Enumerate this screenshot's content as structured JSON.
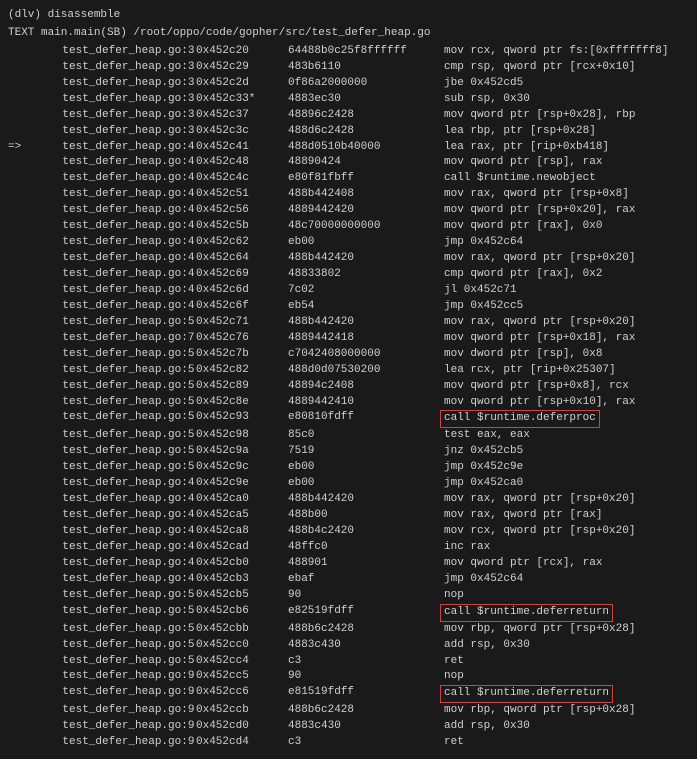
{
  "prompt": "(dlv) disassemble",
  "text_header": "TEXT main.main(SB) /root/oppo/code/gopher/src/test_defer_heap.go",
  "rows": [
    {
      "arrow": "",
      "file": "test_defer_heap.go:3",
      "addr": "0x452c20",
      "bytes": "64488b0c25f8ffffff",
      "instr": "mov rcx, qword ptr fs:[0xfffffff8]",
      "hl": false
    },
    {
      "arrow": "",
      "file": "test_defer_heap.go:3",
      "addr": "0x452c29",
      "bytes": "483b6110",
      "instr": "cmp rsp, qword ptr [rcx+0x10]",
      "hl": false
    },
    {
      "arrow": "",
      "file": "test_defer_heap.go:3",
      "addr": "0x452c2d",
      "bytes": "0f86a2000000",
      "instr": "jbe 0x452cd5",
      "hl": false
    },
    {
      "arrow": "",
      "file": "test_defer_heap.go:3",
      "addr": "0x452c33*",
      "bytes": "4883ec30",
      "instr": "sub rsp, 0x30",
      "hl": false
    },
    {
      "arrow": "",
      "file": "test_defer_heap.go:3",
      "addr": "0x452c37",
      "bytes": "48896c2428",
      "instr": "mov qword ptr [rsp+0x28], rbp",
      "hl": false
    },
    {
      "arrow": "",
      "file": "test_defer_heap.go:3",
      "addr": "0x452c3c",
      "bytes": "488d6c2428",
      "instr": "lea rbp, ptr [rsp+0x28]",
      "hl": false
    },
    {
      "arrow": "=>",
      "file": "test_defer_heap.go:4",
      "addr": "0x452c41",
      "bytes": "488d0510b40000",
      "instr": "lea rax, ptr [rip+0xb418]",
      "hl": false
    },
    {
      "arrow": "",
      "file": "test_defer_heap.go:4",
      "addr": "0x452c48",
      "bytes": "48890424",
      "instr": "mov qword ptr [rsp], rax",
      "hl": false
    },
    {
      "arrow": "",
      "file": "test_defer_heap.go:4",
      "addr": "0x452c4c",
      "bytes": "e80f81fbff",
      "instr": "call $runtime.newobject",
      "hl": false
    },
    {
      "arrow": "",
      "file": "test_defer_heap.go:4",
      "addr": "0x452c51",
      "bytes": "488b442408",
      "instr": "mov rax, qword ptr [rsp+0x8]",
      "hl": false
    },
    {
      "arrow": "",
      "file": "test_defer_heap.go:4",
      "addr": "0x452c56",
      "bytes": "4889442420",
      "instr": "mov qword ptr [rsp+0x20], rax",
      "hl": false
    },
    {
      "arrow": "",
      "file": "test_defer_heap.go:4",
      "addr": "0x452c5b",
      "bytes": "48c70000000000",
      "instr": "mov qword ptr [rax], 0x0",
      "hl": false
    },
    {
      "arrow": "",
      "file": "test_defer_heap.go:4",
      "addr": "0x452c62",
      "bytes": "eb00",
      "instr": "jmp 0x452c64",
      "hl": false
    },
    {
      "arrow": "",
      "file": "test_defer_heap.go:4",
      "addr": "0x452c64",
      "bytes": "488b442420",
      "instr": "mov rax, qword ptr [rsp+0x20]",
      "hl": false
    },
    {
      "arrow": "",
      "file": "test_defer_heap.go:4",
      "addr": "0x452c69",
      "bytes": "48833802",
      "instr": "cmp qword ptr [rax], 0x2",
      "hl": false
    },
    {
      "arrow": "",
      "file": "test_defer_heap.go:4",
      "addr": "0x452c6d",
      "bytes": "7c02",
      "instr": "jl 0x452c71",
      "hl": false
    },
    {
      "arrow": "",
      "file": "test_defer_heap.go:4",
      "addr": "0x452c6f",
      "bytes": "eb54",
      "instr": "jmp 0x452cc5",
      "hl": false
    },
    {
      "arrow": "",
      "file": "test_defer_heap.go:5",
      "addr": "0x452c71",
      "bytes": "488b442420",
      "instr": "mov rax, qword ptr [rsp+0x20]",
      "hl": false
    },
    {
      "arrow": "",
      "file": "test_defer_heap.go:7",
      "addr": "0x452c76",
      "bytes": "4889442418",
      "instr": "mov qword ptr [rsp+0x18], rax",
      "hl": false
    },
    {
      "arrow": "",
      "file": "test_defer_heap.go:5",
      "addr": "0x452c7b",
      "bytes": "c7042408000000",
      "instr": "mov dword ptr [rsp], 0x8",
      "hl": false
    },
    {
      "arrow": "",
      "file": "test_defer_heap.go:5",
      "addr": "0x452c82",
      "bytes": "488d0d07530200",
      "instr": "lea rcx, ptr [rip+0x25307]",
      "hl": false
    },
    {
      "arrow": "",
      "file": "test_defer_heap.go:5",
      "addr": "0x452c89",
      "bytes": "48894c2408",
      "instr": "mov qword ptr [rsp+0x8], rcx",
      "hl": false
    },
    {
      "arrow": "",
      "file": "test_defer_heap.go:5",
      "addr": "0x452c8e",
      "bytes": "4889442410",
      "instr": "mov qword ptr [rsp+0x10], rax",
      "hl": false
    },
    {
      "arrow": "",
      "file": "test_defer_heap.go:5",
      "addr": "0x452c93",
      "bytes": "e80810fdff",
      "instr": "call $runtime.deferproc",
      "hl": true
    },
    {
      "arrow": "",
      "file": "test_defer_heap.go:5",
      "addr": "0x452c98",
      "bytes": "85c0",
      "instr": "test eax, eax",
      "hl": false
    },
    {
      "arrow": "",
      "file": "test_defer_heap.go:5",
      "addr": "0x452c9a",
      "bytes": "7519",
      "instr": "jnz 0x452cb5",
      "hl": false
    },
    {
      "arrow": "",
      "file": "test_defer_heap.go:5",
      "addr": "0x452c9c",
      "bytes": "eb00",
      "instr": "jmp 0x452c9e",
      "hl": false
    },
    {
      "arrow": "",
      "file": "test_defer_heap.go:4",
      "addr": "0x452c9e",
      "bytes": "eb00",
      "instr": "jmp 0x452ca0",
      "hl": false
    },
    {
      "arrow": "",
      "file": "test_defer_heap.go:4",
      "addr": "0x452ca0",
      "bytes": "488b442420",
      "instr": "mov rax, qword ptr [rsp+0x20]",
      "hl": false
    },
    {
      "arrow": "",
      "file": "test_defer_heap.go:4",
      "addr": "0x452ca5",
      "bytes": "488b00",
      "instr": "mov rax, qword ptr [rax]",
      "hl": false
    },
    {
      "arrow": "",
      "file": "test_defer_heap.go:4",
      "addr": "0x452ca8",
      "bytes": "488b4c2420",
      "instr": "mov rcx, qword ptr [rsp+0x20]",
      "hl": false
    },
    {
      "arrow": "",
      "file": "test_defer_heap.go:4",
      "addr": "0x452cad",
      "bytes": "48ffc0",
      "instr": "inc rax",
      "hl": false
    },
    {
      "arrow": "",
      "file": "test_defer_heap.go:4",
      "addr": "0x452cb0",
      "bytes": "488901",
      "instr": "mov qword ptr [rcx], rax",
      "hl": false
    },
    {
      "arrow": "",
      "file": "test_defer_heap.go:4",
      "addr": "0x452cb3",
      "bytes": "ebaf",
      "instr": "jmp 0x452c64",
      "hl": false
    },
    {
      "arrow": "",
      "file": "test_defer_heap.go:5",
      "addr": "0x452cb5",
      "bytes": "90",
      "instr": "nop",
      "hl": false
    },
    {
      "arrow": "",
      "file": "test_defer_heap.go:5",
      "addr": "0x452cb6",
      "bytes": "e82519fdff",
      "instr": "call $runtime.deferreturn",
      "hl": true
    },
    {
      "arrow": "",
      "file": "test_defer_heap.go:5",
      "addr": "0x452cbb",
      "bytes": "488b6c2428",
      "instr": "mov rbp, qword ptr [rsp+0x28]",
      "hl": false
    },
    {
      "arrow": "",
      "file": "test_defer_heap.go:5",
      "addr": "0x452cc0",
      "bytes": "4883c430",
      "instr": "add rsp, 0x30",
      "hl": false
    },
    {
      "arrow": "",
      "file": "test_defer_heap.go:5",
      "addr": "0x452cc4",
      "bytes": "c3",
      "instr": "ret",
      "hl": false
    },
    {
      "arrow": "",
      "file": "test_defer_heap.go:9",
      "addr": "0x452cc5",
      "bytes": "90",
      "instr": "nop",
      "hl": false
    },
    {
      "arrow": "",
      "file": "test_defer_heap.go:9",
      "addr": "0x452cc6",
      "bytes": "e81519fdff",
      "instr": "call $runtime.deferreturn",
      "hl": true
    },
    {
      "arrow": "",
      "file": "test_defer_heap.go:9",
      "addr": "0x452ccb",
      "bytes": "488b6c2428",
      "instr": "mov rbp, qword ptr [rsp+0x28]",
      "hl": false
    },
    {
      "arrow": "",
      "file": "test_defer_heap.go:9",
      "addr": "0x452cd0",
      "bytes": "4883c430",
      "instr": "add rsp, 0x30",
      "hl": false
    },
    {
      "arrow": "",
      "file": "test_defer_heap.go:9",
      "addr": "0x452cd4",
      "bytes": "c3",
      "instr": "ret",
      "hl": false
    }
  ]
}
